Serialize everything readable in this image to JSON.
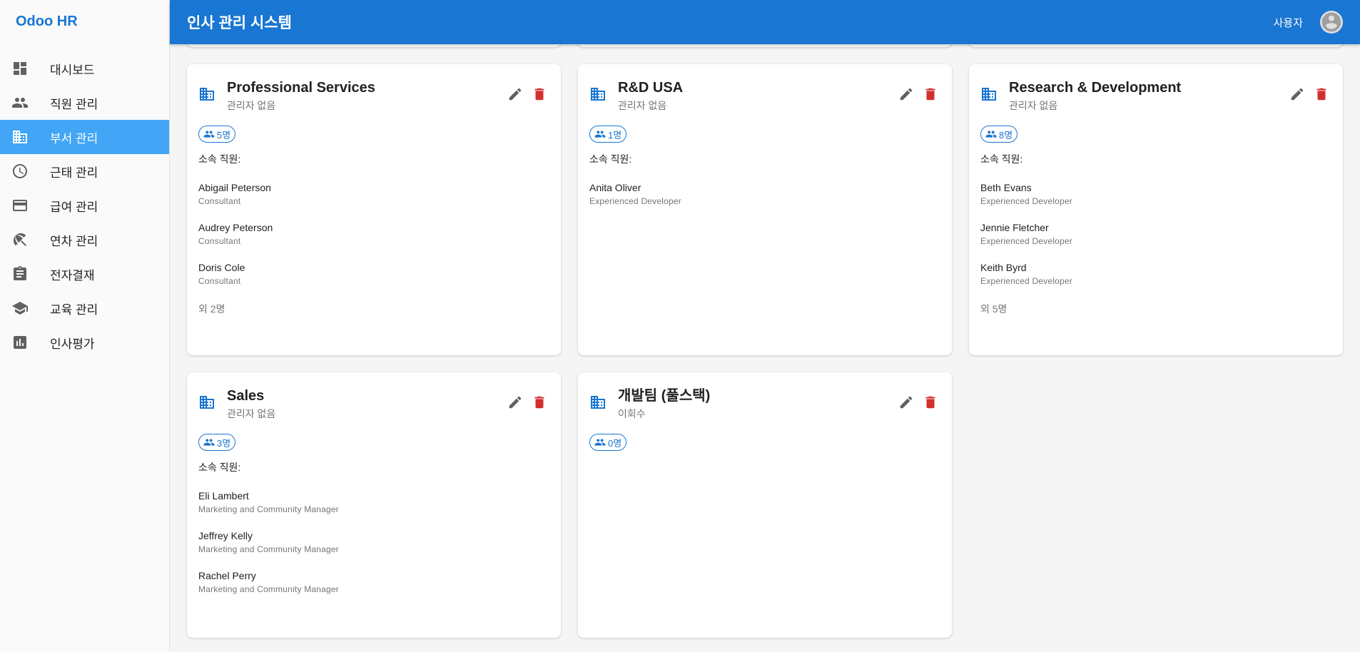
{
  "app": {
    "brand": "Odoo HR",
    "title": "인사 관리 시스템",
    "user": "사용자"
  },
  "sidebar": {
    "items": [
      {
        "label": "대시보드",
        "icon": "dashboard-icon"
      },
      {
        "label": "직원 관리",
        "icon": "people-icon"
      },
      {
        "label": "부서 관리",
        "icon": "building-icon",
        "active": true
      },
      {
        "label": "근태 관리",
        "icon": "clock-icon"
      },
      {
        "label": "급여 관리",
        "icon": "credit-card-icon"
      },
      {
        "label": "연차 관리",
        "icon": "beach-umbrella-icon"
      },
      {
        "label": "전자결재",
        "icon": "clipboard-icon"
      },
      {
        "label": "교육 관리",
        "icon": "school-icon"
      },
      {
        "label": "인사평가",
        "icon": "bar-chart-icon"
      }
    ]
  },
  "colors": {
    "primary": "#1976d2",
    "active": "#42a5f5",
    "danger": "#d32f2f"
  },
  "departments": [
    {
      "name": "Professional Services",
      "manager": "관리자 없음",
      "count": "5명",
      "members_label": "소속 직원:",
      "members": [
        {
          "name": "Abigail Peterson",
          "job": "Consultant"
        },
        {
          "name": "Audrey Peterson",
          "job": "Consultant"
        },
        {
          "name": "Doris Cole",
          "job": "Consultant"
        }
      ],
      "more": "외 2명"
    },
    {
      "name": "R&D USA",
      "manager": "관리자 없음",
      "count": "1명",
      "members_label": "소속 직원:",
      "members": [
        {
          "name": "Anita Oliver",
          "job": "Experienced Developer"
        }
      ]
    },
    {
      "name": "Research & Development",
      "manager": "관리자 없음",
      "count": "8명",
      "members_label": "소속 직원:",
      "members": [
        {
          "name": "Beth Evans",
          "job": "Experienced Developer"
        },
        {
          "name": "Jennie Fletcher",
          "job": "Experienced Developer"
        },
        {
          "name": "Keith Byrd",
          "job": "Experienced Developer"
        }
      ],
      "more": "외 5명"
    },
    {
      "name": "Sales",
      "manager": "관리자 없음",
      "count": "3명",
      "members_label": "소속 직원:",
      "members": [
        {
          "name": "Eli Lambert",
          "job": "Marketing and Community Manager"
        },
        {
          "name": "Jeffrey Kelly",
          "job": "Marketing and Community Manager"
        },
        {
          "name": "Rachel Perry",
          "job": "Marketing and Community Manager"
        }
      ]
    },
    {
      "name": "개발팀 (풀스택)",
      "manager": "이회수",
      "count": "0명",
      "members": []
    }
  ]
}
